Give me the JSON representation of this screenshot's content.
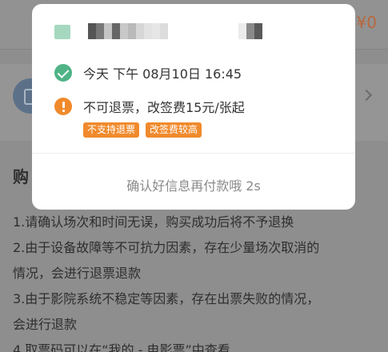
{
  "background": {
    "price": "¥0",
    "section_title": "购",
    "notes": [
      "1.请确认场次和时间无误，购买成功后将不予退换",
      "2.由于设备故障等不可抗力因素，存在少量场次取消的",
      "情况，会进行退票退款",
      "3.由于影院系统不稳定等因素，存在出票失败的情况，",
      "会进行退款",
      "4.取票码可以在“我的 - 电影票”中查看"
    ]
  },
  "modal": {
    "datetime": "今天 下午 08月10日 16:45",
    "refund_policy": "不可退票，改签费15元/张起",
    "tags": [
      "不支持退票",
      "改签费较高"
    ],
    "confirm_text": "确认好信息再付款哦 2s"
  },
  "colors": {
    "success": "#4fb386",
    "warning": "#f08a2c",
    "tag_bg": "#f08a2c"
  },
  "icons": {
    "check": "check-circle-icon",
    "warning": "warning-circle-icon"
  }
}
